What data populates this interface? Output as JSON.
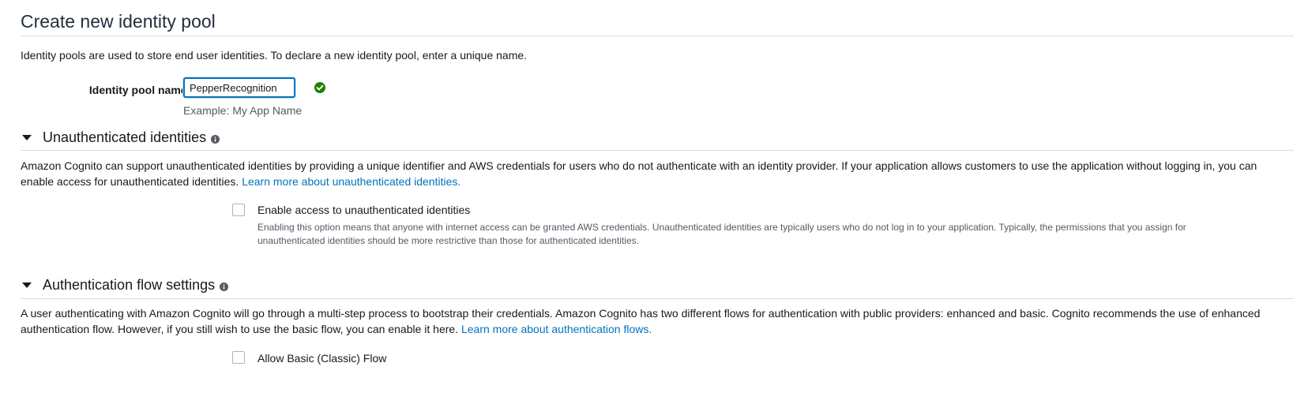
{
  "page": {
    "title": "Create new identity pool",
    "intro": "Identity pools are used to store end user identities. To declare a new identity pool, enter a unique name."
  },
  "pool_name": {
    "label": "Identity pool name*",
    "value": "PepperRecognition",
    "hint": "Example: My App Name",
    "status_icon": "check-circle-icon",
    "status_color": "#1d8102"
  },
  "unauth": {
    "title": "Unauthenticated identities",
    "info_icon": "info-icon",
    "description": "Amazon Cognito can support unauthenticated identities by providing a unique identifier and AWS credentials for users who do not authenticate with an identity provider. If your application allows customers to use the application without logging in, you can enable access for unauthenticated identities.",
    "link": "Learn more about unauthenticated identities.",
    "checkbox_label": "Enable access to unauthenticated identities",
    "checkbox_checked": false,
    "checkbox_description": "Enabling this option means that anyone with internet access can be granted AWS credentials. Unauthenticated identities are typically users who do not log in to your application. Typically, the permissions that you assign for unauthenticated identities should be more restrictive than those for authenticated identities."
  },
  "auth_flow": {
    "title": "Authentication flow settings",
    "info_icon": "info-icon",
    "description": "A user authenticating with Amazon Cognito will go through a multi-step process to bootstrap their credentials. Amazon Cognito has two different flows for authentication with public providers: enhanced and basic. Cognito recommends the use of enhanced authentication flow. However, if you still wish to use the basic flow, you can enable it here.",
    "link": "Learn more about authentication flows.",
    "checkbox_label": "Allow Basic (Classic) Flow",
    "checkbox_checked": false
  },
  "colors": {
    "link": "#0073bb",
    "input_border": "#0073bb",
    "success": "#1d8102"
  }
}
